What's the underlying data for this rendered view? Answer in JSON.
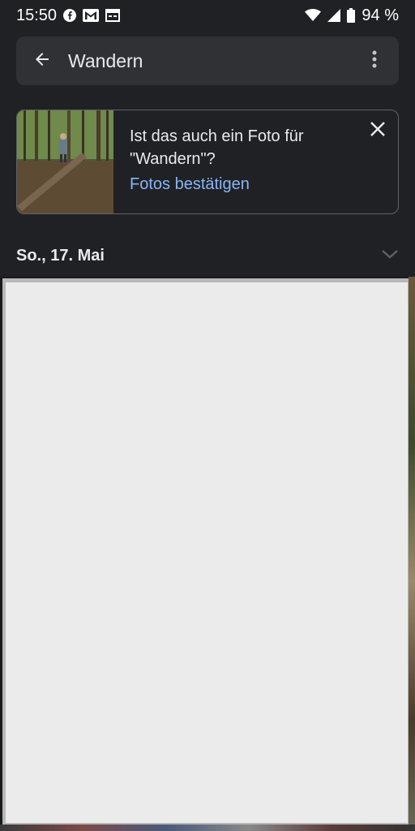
{
  "status_bar": {
    "time": "15:50",
    "notification_icons": [
      "facebook-icon",
      "gmail-icon",
      "calendar-icon"
    ],
    "battery": "94 %"
  },
  "search": {
    "query": "Wandern"
  },
  "suggestion_card": {
    "question": "Ist das auch ein Foto für \"Wandern\"?",
    "confirm_link": "Fotos bestätigen"
  },
  "date_section": {
    "label": "So., 17. Mai"
  },
  "colors": {
    "background": "#202124",
    "search_bg": "#303134",
    "link": "#8ab4f8",
    "text": "#e8eaed"
  }
}
